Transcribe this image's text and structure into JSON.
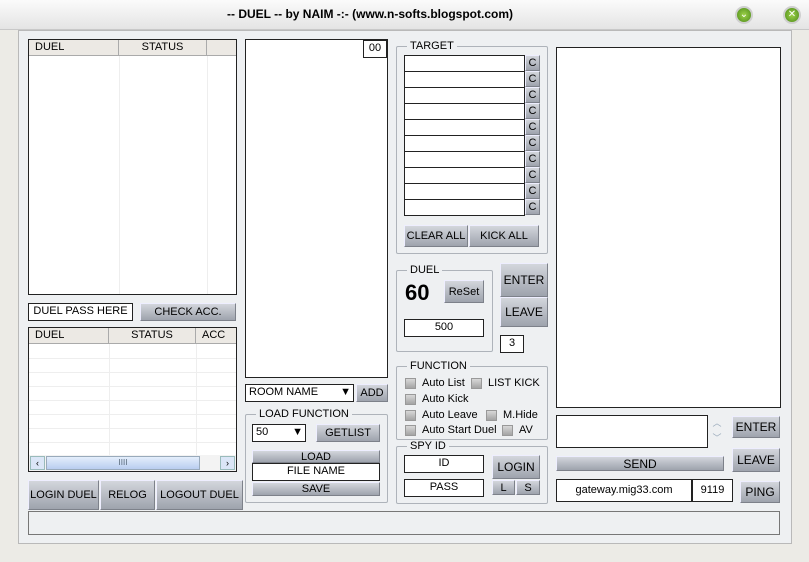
{
  "window": {
    "title": "-- DUEL -- by NAIM  -:-  (www.n-softs.blogspot.com)",
    "minimize_icon": "chevron-down",
    "close_icon": "close"
  },
  "left": {
    "list1": {
      "columns": [
        "DUEL",
        "STATUS",
        ""
      ]
    },
    "duel_pass": "DUEL PASS HERE",
    "check_acc": "CHECK ACC.",
    "list2": {
      "columns": [
        "DUEL",
        "STATUS",
        "ACC"
      ],
      "scroll_grip": "IIII"
    },
    "buttons": {
      "login_duel": "LOGIN DUEL",
      "relog": "RELOG",
      "logout_duel": "LOGOUT DUEL"
    }
  },
  "middle": {
    "count": "00",
    "room_name": "ROOM NAME",
    "add": "ADD",
    "load_function": {
      "label": "LOAD FUNCTION",
      "selected": "50",
      "getlist": "GETLIST",
      "load": "LOAD",
      "file_name": "FILE NAME",
      "save": "SAVE"
    }
  },
  "target": {
    "label": "TARGET",
    "clear_label": "C",
    "rows": 10,
    "clear_all": "CLEAR ALL",
    "kick_all": "KICK ALL"
  },
  "duel": {
    "label": "DUEL",
    "timer": "60",
    "reset": "ReSet",
    "value": "500",
    "enter": "ENTER",
    "leave": "LEAVE",
    "count": "3"
  },
  "function": {
    "label": "FUNCTION",
    "options": [
      "Auto List",
      "LIST KICK",
      "Auto Kick",
      "Auto Leave",
      "M.Hide",
      "Auto Start Duel",
      "AV"
    ]
  },
  "spy": {
    "label": "SPY ID",
    "id": "ID",
    "pass": "PASS",
    "login": "LOGIN",
    "l": "L",
    "s": "S"
  },
  "right": {
    "enter": "ENTER",
    "send": "SEND",
    "leave": "LEAVE",
    "server": "gateway.mig33.com",
    "port": "9119",
    "ping": "PING"
  }
}
